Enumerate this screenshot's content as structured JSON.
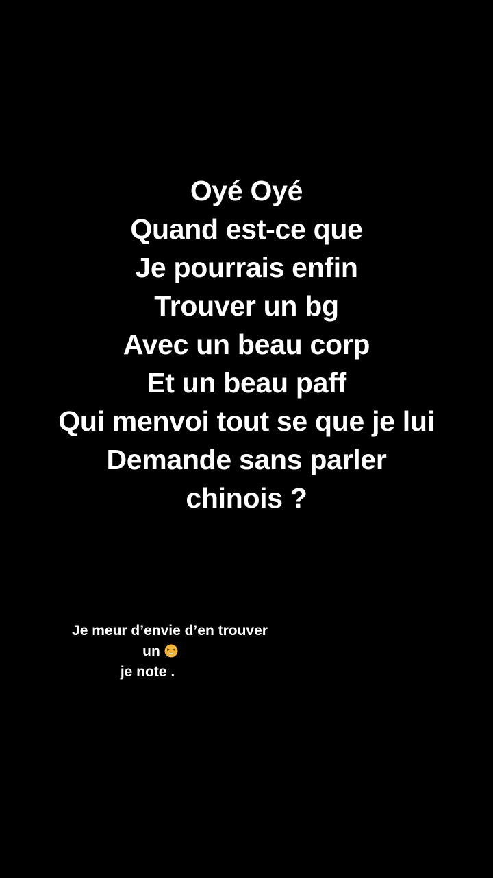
{
  "main_text": {
    "lines": [
      "Oyé Oyé",
      "Quand est-ce que",
      "Je pourrais enfin",
      "Trouver un bg",
      "Avec un beau corp",
      "Et un beau paff",
      "Qui menvoi tout se que je lui",
      "Demande sans parler",
      "chinois ?"
    ]
  },
  "caption": {
    "line1": "Je meur d’envie d’en trouver",
    "line2": "un",
    "line2_icon": "tired-face-emoji-icon",
    "line3": "je note ."
  },
  "colors": {
    "background": "#000000",
    "text": "#ffffff",
    "emoji": "#f5b731"
  }
}
